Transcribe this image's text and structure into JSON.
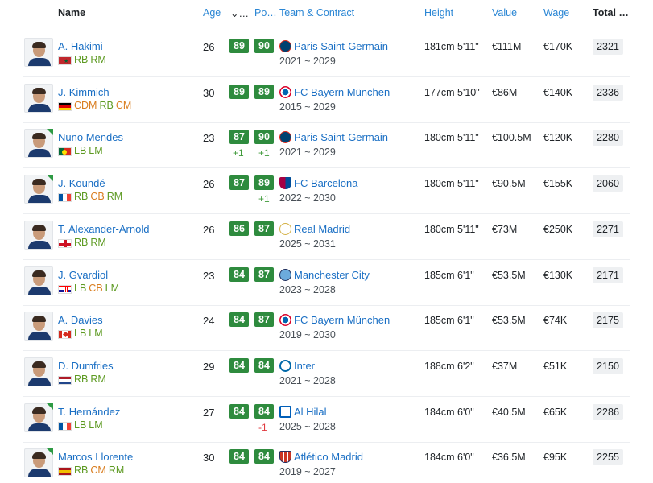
{
  "header": {
    "name": "Name",
    "age": "Age",
    "ovr_sort": "⌄…",
    "pot": "Po…",
    "team_contract": "Team & Contract",
    "height": "Height",
    "value": "Value",
    "wage": "Wage",
    "total": "Total …"
  },
  "colors": {
    "rating_bg": "#2e8b3e",
    "link": "#1a6fc4",
    "pos_green": "#5d9a22",
    "pos_orange": "#d97d1f",
    "delta_up": "#3f9a3a",
    "delta_down": "#e0393e"
  },
  "players": [
    {
      "name": "A. Hakimi",
      "nation": "Morocco",
      "positions": [
        "RB",
        "RM"
      ],
      "age": "26",
      "ovr": "89",
      "pot": "90",
      "ovr_delta": "",
      "pot_delta": "",
      "club": "Paris Saint-Germain",
      "contract": "2021 ~ 2029",
      "height": "181cm 5'11\"",
      "value": "€111M",
      "wage": "€170K",
      "total": "2321",
      "new": false
    },
    {
      "name": "J. Kimmich",
      "nation": "Germany",
      "positions": [
        "CDM",
        "RB",
        "CM"
      ],
      "age": "30",
      "ovr": "89",
      "pot": "89",
      "ovr_delta": "",
      "pot_delta": "",
      "club": "FC Bayern München",
      "contract": "2015 ~ 2029",
      "height": "177cm 5'10\"",
      "value": "€86M",
      "wage": "€140K",
      "total": "2336",
      "new": false
    },
    {
      "name": "Nuno Mendes",
      "nation": "Portugal",
      "positions": [
        "LB",
        "LM"
      ],
      "age": "23",
      "ovr": "87",
      "pot": "90",
      "ovr_delta": "+1",
      "pot_delta": "+1",
      "club": "Paris Saint-Germain",
      "contract": "2021 ~ 2029",
      "height": "180cm 5'11\"",
      "value": "€100.5M",
      "wage": "€120K",
      "total": "2280",
      "new": true
    },
    {
      "name": "J. Koundé",
      "nation": "France",
      "positions": [
        "RB",
        "CB",
        "RM"
      ],
      "age": "26",
      "ovr": "87",
      "pot": "89",
      "ovr_delta": "",
      "pot_delta": "+1",
      "club": "FC Barcelona",
      "contract": "2022 ~ 2030",
      "height": "180cm 5'11\"",
      "value": "€90.5M",
      "wage": "€155K",
      "total": "2060",
      "new": true
    },
    {
      "name": "T. Alexander-Arnold",
      "nation": "England",
      "positions": [
        "RB",
        "RM"
      ],
      "age": "26",
      "ovr": "86",
      "pot": "87",
      "ovr_delta": "",
      "pot_delta": "",
      "club": "Real Madrid",
      "contract": "2025 ~ 2031",
      "height": "180cm 5'11\"",
      "value": "€73M",
      "wage": "€250K",
      "total": "2271",
      "new": false
    },
    {
      "name": "J. Gvardiol",
      "nation": "Croatia",
      "positions": [
        "LB",
        "CB",
        "LM"
      ],
      "age": "23",
      "ovr": "84",
      "pot": "87",
      "ovr_delta": "",
      "pot_delta": "",
      "club": "Manchester City",
      "contract": "2023 ~ 2028",
      "height": "185cm 6'1\"",
      "value": "€53.5M",
      "wage": "€130K",
      "total": "2171",
      "new": false
    },
    {
      "name": "A. Davies",
      "nation": "Canada",
      "positions": [
        "LB",
        "LM"
      ],
      "age": "24",
      "ovr": "84",
      "pot": "87",
      "ovr_delta": "",
      "pot_delta": "",
      "club": "FC Bayern München",
      "contract": "2019 ~ 2030",
      "height": "185cm 6'1\"",
      "value": "€53.5M",
      "wage": "€74K",
      "total": "2175",
      "new": false
    },
    {
      "name": "D. Dumfries",
      "nation": "Netherlands",
      "positions": [
        "RB",
        "RM"
      ],
      "age": "29",
      "ovr": "84",
      "pot": "84",
      "ovr_delta": "",
      "pot_delta": "",
      "club": "Inter",
      "contract": "2021 ~ 2028",
      "height": "188cm 6'2\"",
      "value": "€37M",
      "wage": "€51K",
      "total": "2150",
      "new": false
    },
    {
      "name": "T. Hernández",
      "nation": "France",
      "positions": [
        "LB",
        "LM"
      ],
      "age": "27",
      "ovr": "84",
      "pot": "84",
      "ovr_delta": "",
      "pot_delta": "-1",
      "club": "Al Hilal",
      "contract": "2025 ~ 2028",
      "height": "184cm 6'0\"",
      "value": "€40.5M",
      "wage": "€65K",
      "total": "2286",
      "new": true
    },
    {
      "name": "Marcos Llorente",
      "nation": "Spain",
      "positions": [
        "RB",
        "CM",
        "RM"
      ],
      "age": "30",
      "ovr": "84",
      "pot": "84",
      "ovr_delta": "",
      "pot_delta": "",
      "club": "Atlético Madrid",
      "contract": "2019 ~ 2027",
      "height": "184cm 6'0\"",
      "value": "€36.5M",
      "wage": "€95K",
      "total": "2255",
      "new": true
    }
  ]
}
